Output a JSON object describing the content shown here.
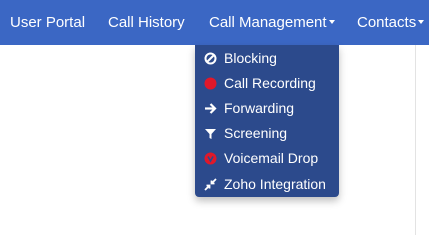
{
  "navbar": {
    "items": [
      {
        "label": "User Portal",
        "has_dropdown": false
      },
      {
        "label": "Call History",
        "has_dropdown": false
      },
      {
        "label": "Call Management",
        "has_dropdown": true,
        "open": true
      },
      {
        "label": "Contacts",
        "has_dropdown": true
      }
    ],
    "background_color": "#3b67c4"
  },
  "call_management_menu": {
    "items": [
      {
        "label": "Blocking",
        "icon": "ban-icon"
      },
      {
        "label": "Call Recording",
        "icon": "record-icon"
      },
      {
        "label": "Forwarding",
        "icon": "arrow-right-icon"
      },
      {
        "label": "Screening",
        "icon": "filter-icon"
      },
      {
        "label": "Voicemail Drop",
        "icon": "voicemail-icon"
      },
      {
        "label": "Zoho Integration",
        "icon": "compress-icon"
      }
    ],
    "background_color": "#2c4a8c",
    "record_icon_color": "#e0182a"
  }
}
